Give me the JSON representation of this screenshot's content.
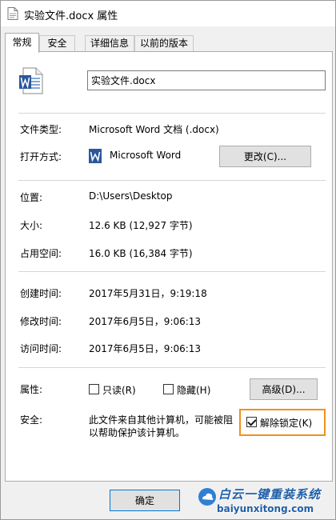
{
  "window": {
    "title": "实验文件.docx 属性"
  },
  "tabs": [
    {
      "label": "常规",
      "active": true
    },
    {
      "label": "安全",
      "active": false
    },
    {
      "label": "详细信息",
      "active": false
    },
    {
      "label": "以前的版本",
      "active": false
    }
  ],
  "file": {
    "name": "实验文件.docx",
    "icon": "word-document-icon"
  },
  "info": {
    "type_label": "文件类型:",
    "type_value": "Microsoft Word 文档 (.docx)",
    "opens_with_label": "打开方式:",
    "opens_with_value": "Microsoft Word",
    "change_button": "更改(C)...",
    "location_label": "位置:",
    "location_value": "D:\\Users\\Desktop",
    "size_label": "大小:",
    "size_value": "12.6 KB (12,927 字节)",
    "size_on_disk_label": "占用空间:",
    "size_on_disk_value": "16.0 KB (16,384 字节)",
    "created_label": "创建时间:",
    "created_value": "2017年5月31日，9:19:18",
    "modified_label": "修改时间:",
    "modified_value": "2017年6月5日，9:06:13",
    "accessed_label": "访问时间:",
    "accessed_value": "2017年6月5日，9:06:13"
  },
  "attributes": {
    "label": "属性:",
    "readonly_label": "只读(R)",
    "readonly_checked": false,
    "hidden_label": "隐藏(H)",
    "hidden_checked": false,
    "advanced_button": "高级(D)..."
  },
  "security": {
    "label": "安全:",
    "message_line1": "此文件来自其他计算机，可能被阻",
    "message_line2": "以帮助保护该计算机。",
    "unblock_label": "解除锁定(K)",
    "unblock_checked": true,
    "highlight_color": "#f0901c"
  },
  "footer": {
    "ok_button": "确定"
  },
  "watermark": {
    "title": "白云一键重装系统",
    "url": "baiyunxitong.com"
  }
}
